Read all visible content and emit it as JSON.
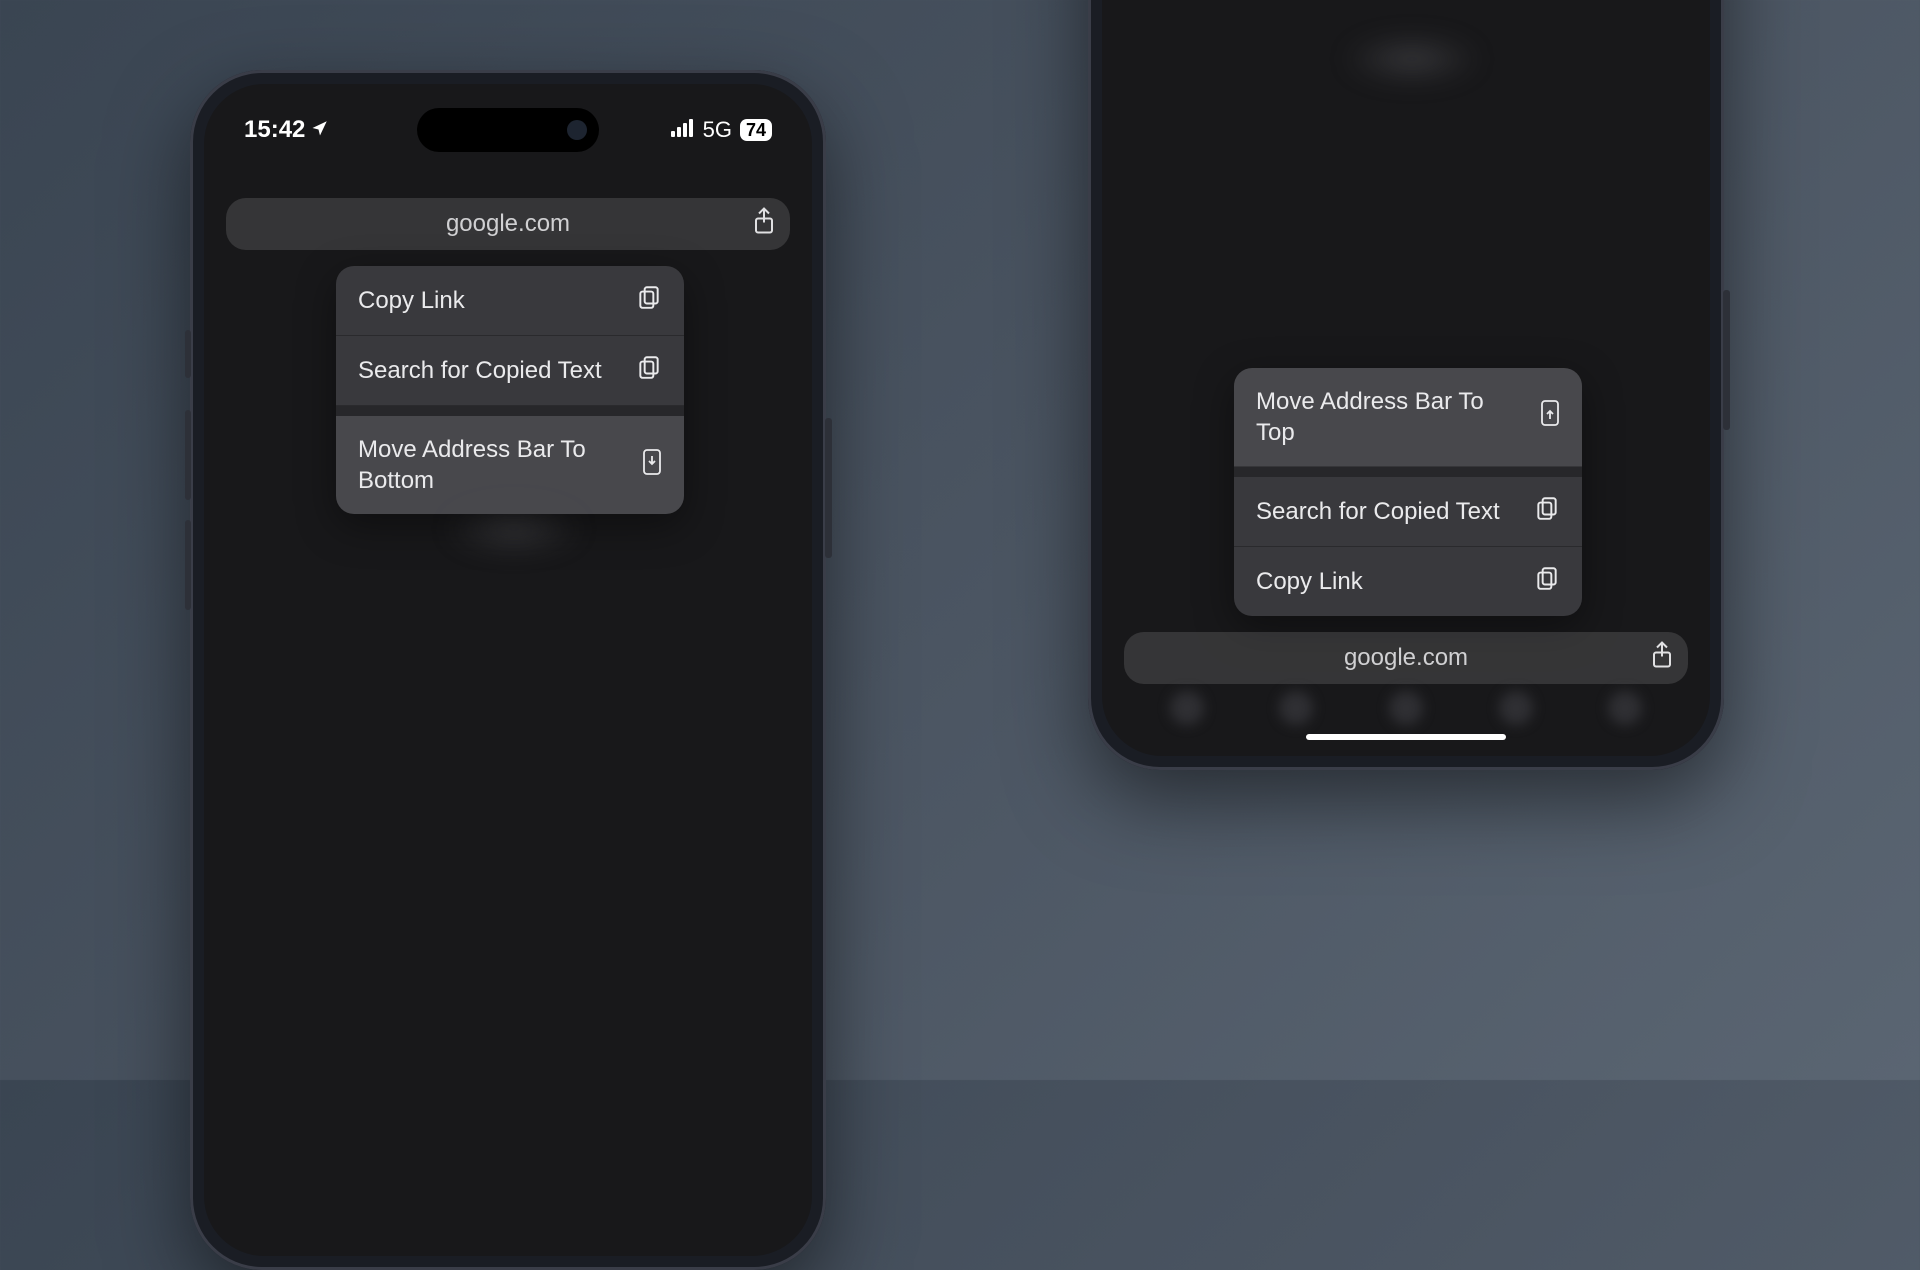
{
  "left_phone": {
    "status": {
      "time": "15:42",
      "network": "5G",
      "battery": "74"
    },
    "address_bar": {
      "url": "google.com"
    },
    "menu": {
      "items": [
        {
          "label": "Copy Link",
          "icon": "copy"
        },
        {
          "label": "Search for Copied Text",
          "icon": "paste-search"
        }
      ],
      "move_item": {
        "label": "Move Address Bar To Bottom",
        "icon": "phone-down"
      }
    }
  },
  "right_phone": {
    "address_bar": {
      "url": "google.com"
    },
    "menu": {
      "move_item": {
        "label": "Move Address Bar To Top",
        "icon": "phone-up"
      },
      "items": [
        {
          "label": "Search for Copied Text",
          "icon": "paste-search"
        },
        {
          "label": "Copy Link",
          "icon": "copy"
        }
      ]
    }
  }
}
